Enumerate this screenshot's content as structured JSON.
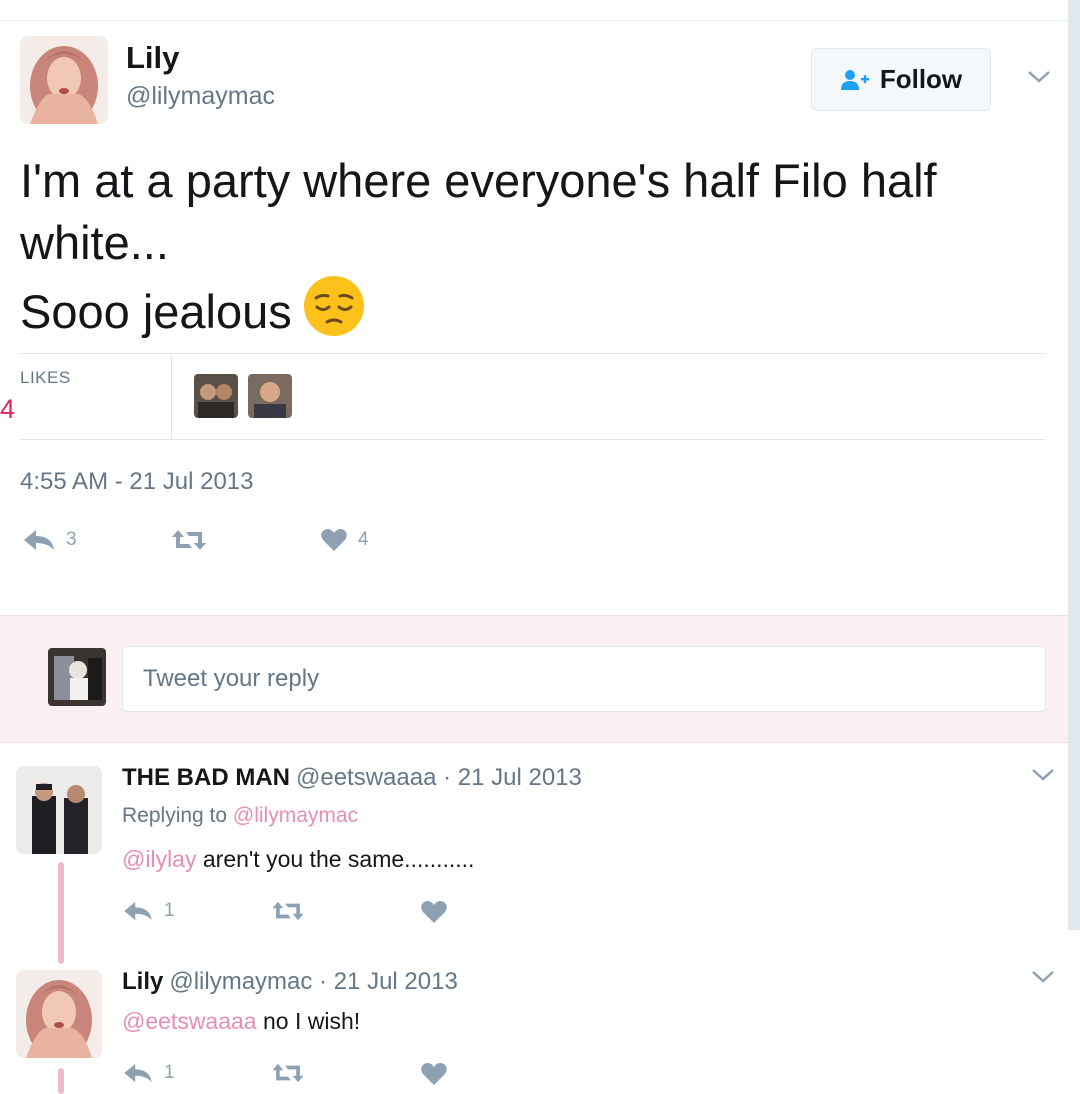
{
  "tweet": {
    "author_name": "Lily",
    "author_handle": "@lilymaymac",
    "follow_label": "Follow",
    "text_line1": "I'm at a party where everyone's half Filo half",
    "text_line2": "white...",
    "text_line3": "Sooo jealous",
    "emoji": "pensive-face",
    "likes_label": "LIKES",
    "likes_count": "4",
    "timestamp": "4:55 AM - 21 Jul 2013",
    "reply_count": "3",
    "like_count": "4"
  },
  "reply_box": {
    "placeholder": "Tweet your reply"
  },
  "replies": [
    {
      "name": "THE BAD MAN",
      "meta": "@eetswaaaa · 21 Jul 2013",
      "replying_label": "Replying to",
      "replying_to": "@lilymaymac",
      "mention": "@ilylay",
      "text": " aren't you the same...........",
      "reply_count": "1"
    },
    {
      "name": "Lily",
      "meta": "@lilymaymac · 21 Jul 2013",
      "mention": "@eetswaaaa",
      "text": " no I wish!",
      "reply_count": "1"
    }
  ],
  "colors": {
    "accent_pink": "#e0245e",
    "mention_pink": "#e590b0",
    "icon_gray": "#8ea1b2",
    "follow_icon": "#1da1f2"
  }
}
